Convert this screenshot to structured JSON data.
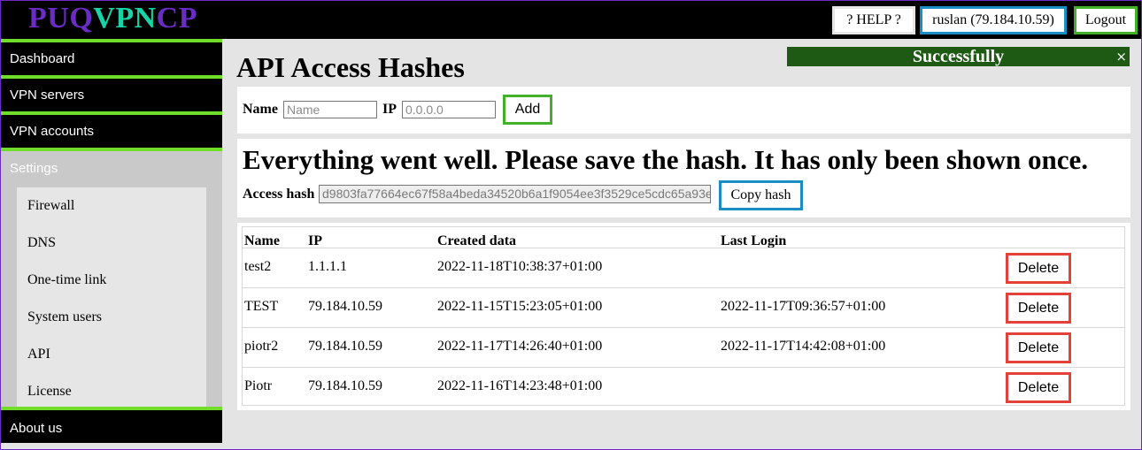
{
  "header": {
    "logo": {
      "part1": "PUQ",
      "part2": "VPN",
      "part3": "CP"
    },
    "help_label": "? HELP ?",
    "user_label": "ruslan (79.184.10.59)",
    "logout_label": "Logout"
  },
  "sidebar": {
    "dashboard": "Dashboard",
    "vpn_servers": "VPN servers",
    "vpn_accounts": "VPN accounts",
    "settings": "Settings",
    "settings_items": [
      "Firewall",
      "DNS",
      "One-time link",
      "System users",
      "API",
      "License"
    ],
    "about": "About us"
  },
  "page": {
    "title": "API Access Hashes"
  },
  "toast": {
    "message": "Successfully",
    "close": "×"
  },
  "add_form": {
    "name_label": "Name",
    "name_placeholder": "Name",
    "ip_label": "IP",
    "ip_placeholder": "0.0.0.0",
    "add_button": "Add"
  },
  "hash_panel": {
    "message": "Everything went well. Please save the hash. It has only been shown once.",
    "access_hash_label": "Access hash",
    "access_hash_value": "d9803fa77664ec67f58a4beda34520b6a1f9054ee3f3529ce5cdc65a93e",
    "copy_button": "Copy hash"
  },
  "table": {
    "columns": [
      "Name",
      "IP",
      "Created data",
      "Last Login"
    ],
    "delete_label": "Delete",
    "rows": [
      {
        "name": "test2",
        "ip": "1.1.1.1",
        "created": "2022-11-18T10:38:37+01:00",
        "last_login": ""
      },
      {
        "name": "TEST",
        "ip": "79.184.10.59",
        "created": "2022-11-15T15:23:05+01:00",
        "last_login": "2022-11-17T09:36:57+01:00"
      },
      {
        "name": "piotr2",
        "ip": "79.184.10.59",
        "created": "2022-11-17T14:26:40+01:00",
        "last_login": "2022-11-17T14:42:08+01:00"
      },
      {
        "name": "Piotr",
        "ip": "79.184.10.59",
        "created": "2022-11-16T14:23:48+01:00",
        "last_login": ""
      }
    ]
  },
  "colors": {
    "accent_purple": "#6a2cc4",
    "accent_teal": "#18d2a8",
    "nav_green": "#6fdd2a",
    "toast_green": "#1e5a14",
    "delete_red": "#e2423a",
    "blue": "#1a8ec4"
  }
}
